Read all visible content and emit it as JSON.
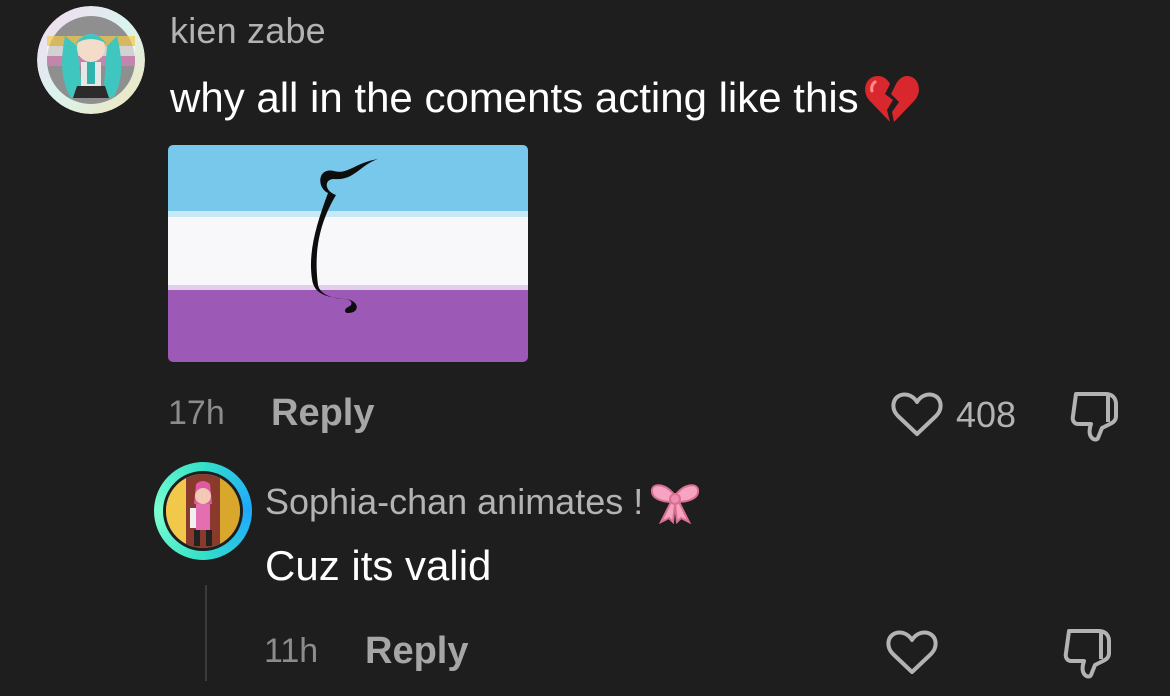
{
  "comment": {
    "username": "kien zabe",
    "text": "why all in the coments acting like this",
    "emoji_icon": "broken-heart-icon",
    "image_icon": "pride-flag-image",
    "flag_colors": [
      "#78c8ec",
      "#ffffff",
      "#9c59b5"
    ],
    "time": "17h",
    "reply_label": "Reply",
    "like_count": "408"
  },
  "reply": {
    "username": "Sophia-chan animates !",
    "emoji_icon": "ribbon-bow-icon",
    "text": "Cuz its valid",
    "time": "11h",
    "reply_label": "Reply"
  },
  "colors": {
    "background": "#1e1e1e",
    "secondary_text": "#b3b3b3",
    "ring_accent": "#33e0c8"
  }
}
